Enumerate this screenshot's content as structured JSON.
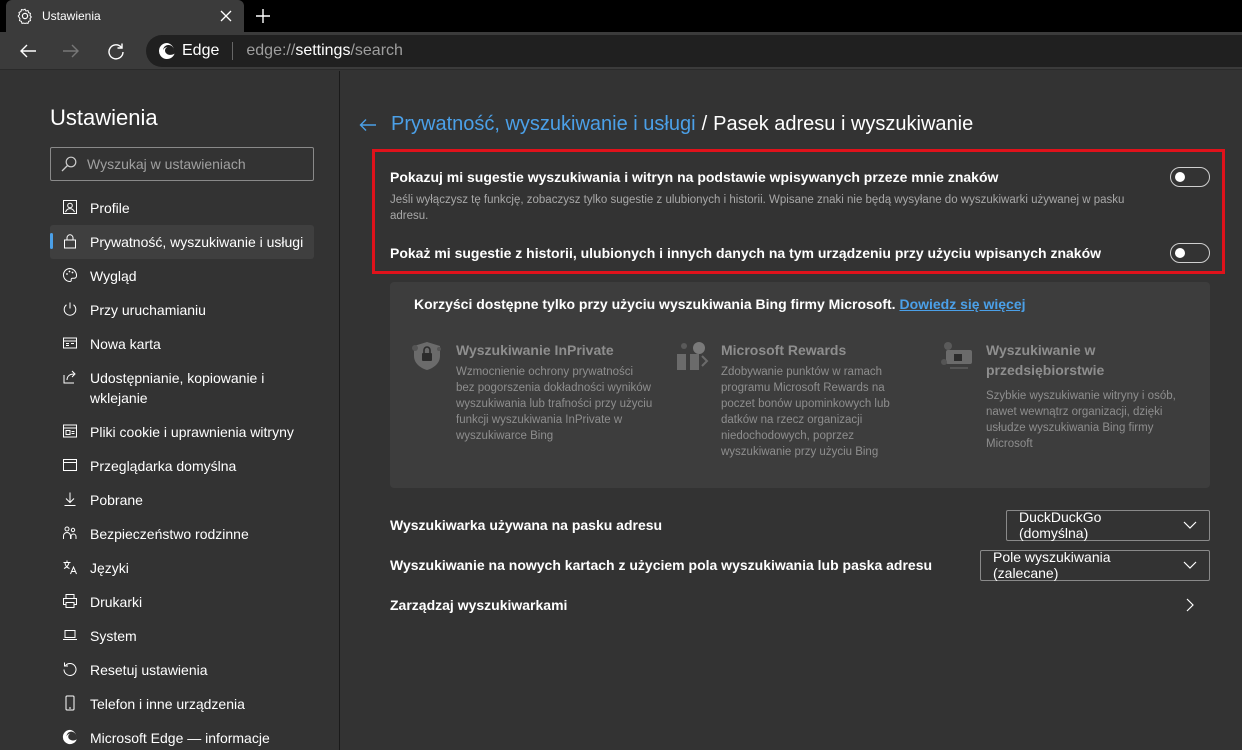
{
  "tab": {
    "title": "Ustawienia"
  },
  "address": {
    "brand": "Edge",
    "url_prefix": "edge://",
    "url_host": "settings",
    "url_path": "/search"
  },
  "sidebar": {
    "title": "Ustawienia",
    "search_placeholder": "Wyszukaj w ustawieniach",
    "items": [
      {
        "label": "Profile",
        "icon": "profile-icon"
      },
      {
        "label": "Prywatność, wyszukiwanie i usługi",
        "icon": "lock-icon",
        "active": true
      },
      {
        "label": "Wygląd",
        "icon": "palette-icon"
      },
      {
        "label": "Przy uruchamianiu",
        "icon": "power-icon"
      },
      {
        "label": "Nowa karta",
        "icon": "new-tab-icon"
      },
      {
        "label": "Udostępnianie, kopiowanie i wklejanie",
        "icon": "share-icon"
      },
      {
        "label": "Pliki cookie i uprawnienia witryny",
        "icon": "site-permissions-icon"
      },
      {
        "label": "Przeglądarka domyślna",
        "icon": "browser-icon"
      },
      {
        "label": "Pobrane",
        "icon": "download-icon"
      },
      {
        "label": "Bezpieczeństwo rodzinne",
        "icon": "family-icon"
      },
      {
        "label": "Języki",
        "icon": "languages-icon"
      },
      {
        "label": "Drukarki",
        "icon": "printer-icon"
      },
      {
        "label": "System",
        "icon": "laptop-icon"
      },
      {
        "label": "Resetuj ustawienia",
        "icon": "reset-icon"
      },
      {
        "label": "Telefon i inne urządzenia",
        "icon": "phone-icon"
      },
      {
        "label": "Microsoft Edge — informacje",
        "icon": "edge-icon"
      }
    ]
  },
  "breadcrumb": {
    "parent": "Prywatność, wyszukiwanie i usługi",
    "separator": "/",
    "current": "Pasek adresu i wyszukiwanie"
  },
  "options": [
    {
      "title": "Pokazuj mi sugestie wyszukiwania i witryn na podstawie wpisywanych przeze mnie znaków",
      "desc": "Jeśli wyłączysz tę funkcję, zobaczysz tylko sugestie z ulubionych i historii. Wpisane znaki nie będą wysyłane do wyszukiwarki używanej w pasku adresu.",
      "enabled": false
    },
    {
      "title": "Pokaż mi sugestie z historii, ulubionych i innych danych na tym urządzeniu przy użyciu wpisanych znaków",
      "enabled": false
    }
  ],
  "bing": {
    "intro": "Korzyści dostępne tylko przy użyciu wyszukiwania Bing firmy Microsoft.",
    "learn_more": "Dowiedz się więcej",
    "features": [
      {
        "title": "Wyszukiwanie InPrivate",
        "desc": "Wzmocnienie ochrony prywatności bez pogorszenia dokładności wyników wyszukiwania lub trafności przy użyciu funkcji wyszukiwania InPrivate w wyszukiwarce Bing",
        "icon": "inprivate-shield-icon"
      },
      {
        "title": "Microsoft Rewards",
        "desc": "Zdobywanie punktów w ramach programu Microsoft Rewards na poczet bonów upominkowych lub datków na rzecz organizacji niedochodowych, poprzez wyszukiwanie przy użyciu Bing",
        "icon": "rewards-icon"
      },
      {
        "title": "Wyszukiwanie w przedsiębiorstwie",
        "desc": "Szybkie wyszukiwanie witryny i osób, nawet wewnątrz organizacji, dzięki usłudze wyszukiwania Bing firmy Microsoft",
        "icon": "enterprise-search-icon"
      }
    ]
  },
  "settings_rows": {
    "engine_label": "Wyszukiwarka używana na pasku adresu",
    "engine_value": "DuckDuckGo (domyślna)",
    "newtab_label": "Wyszukiwanie na nowych kartach z użyciem pola wyszukiwania lub paska adresu",
    "newtab_value": "Pole wyszukiwania (zalecane)",
    "manage_label": "Zarządzaj wyszukiwarkami"
  },
  "colors": {
    "accent": "#4ba0e8",
    "highlight_border": "#e0121b",
    "background": "#333333"
  }
}
